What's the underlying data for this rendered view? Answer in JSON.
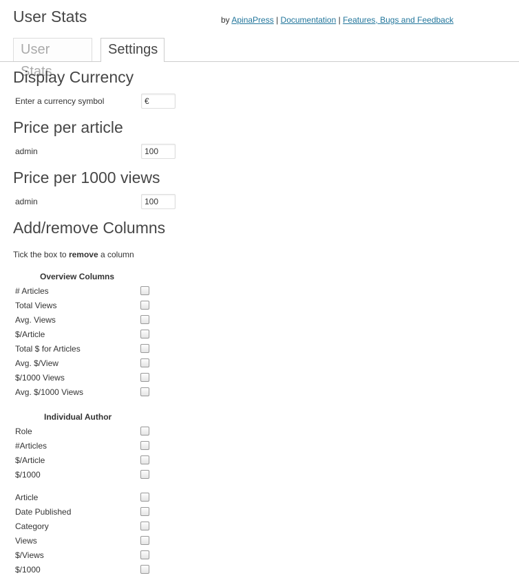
{
  "header": {
    "title": "User Stats",
    "by_prefix": "by",
    "links": [
      "ApinaPress",
      "Documentation",
      "Features, Bugs and Feedback"
    ],
    "separator": "|"
  },
  "tabs": [
    {
      "label": "User Stats",
      "active": false
    },
    {
      "label": "Settings",
      "active": true
    }
  ],
  "currency": {
    "heading": "Display Currency",
    "label": "Enter a currency symbol",
    "value": "€"
  },
  "price_article": {
    "heading": "Price per article",
    "label": "admin",
    "value": "100"
  },
  "price_views": {
    "heading": "Price per 1000 views",
    "label": "admin",
    "value": "100"
  },
  "columns": {
    "heading": "Add/remove Columns",
    "hint_pre": "Tick the box to",
    "hint_bold": "remove",
    "hint_post": "a column",
    "overview_heading": "Overview Columns",
    "overview": [
      "# Articles",
      "Total Views",
      "Avg. Views",
      "$/Article",
      "Total $ for Articles",
      "Avg. $/View",
      "$/1000 Views",
      "Avg. $/1000 Views"
    ],
    "author_heading": "Individual Author",
    "author": [
      "Role",
      "#Articles",
      "$/Article",
      "$/1000"
    ],
    "article": [
      "Article",
      "Date Published",
      "Category",
      "Views",
      "$/Views",
      "$/1000"
    ]
  },
  "colors": {
    "link": "#21759b",
    "heading": "#464646"
  }
}
